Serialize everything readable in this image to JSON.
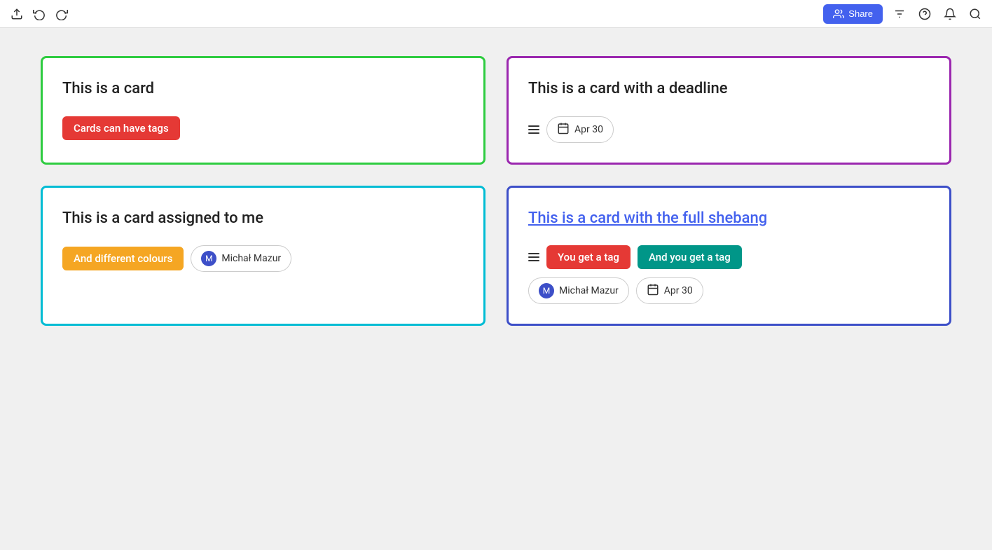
{
  "toolbar": {
    "share_label": "Share",
    "icons": [
      "upload",
      "undo",
      "redo",
      "filters",
      "help",
      "notifications",
      "search"
    ]
  },
  "cards": [
    {
      "id": "card-1",
      "border_color": "green",
      "title": "This is a card",
      "title_is_link": false,
      "tags": [
        {
          "label": "Cards can have tags",
          "color": "red"
        }
      ],
      "assignees": [],
      "deadline": null,
      "has_lines_icon": false
    },
    {
      "id": "card-2",
      "border_color": "purple",
      "title": "This is a card with a deadline",
      "title_is_link": false,
      "tags": [],
      "assignees": [],
      "deadline": "Apr 30",
      "has_lines_icon": true
    },
    {
      "id": "card-3",
      "border_color": "cyan",
      "title": "This is a card assigned to me",
      "title_is_link": false,
      "tags": [
        {
          "label": "And different colours",
          "color": "yellow"
        }
      ],
      "assignees": [
        "Michał Mazur"
      ],
      "deadline": null,
      "has_lines_icon": false
    },
    {
      "id": "card-4",
      "border_color": "blue",
      "title": "This is a card with the full shebang",
      "title_is_link": true,
      "tags": [
        {
          "label": "You get a tag",
          "color": "red"
        },
        {
          "label": "And you get a tag",
          "color": "teal"
        }
      ],
      "assignees": [
        "Michał Mazur"
      ],
      "deadline": "Apr 30",
      "has_lines_icon": true
    }
  ]
}
